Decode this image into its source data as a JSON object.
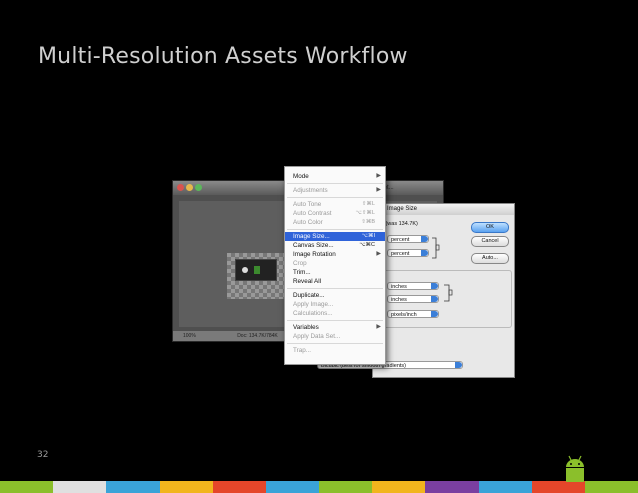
{
  "slide": {
    "title": "Multi-Resolution Assets Workflow",
    "page_number": "32"
  },
  "colors": {
    "background": "#000000",
    "title_text": "#cfcfcf",
    "menu_highlight": "#2f63d9",
    "bottom_stripes": [
      "#8bbf2b",
      "#e0e0e0",
      "#3aa3d8",
      "#f2b51d",
      "#e5462a",
      "#3aa3d8",
      "#8bbf2b",
      "#f2b51d",
      "#7a3fa0",
      "#3aa3d8",
      "#e5462a",
      "#8bbf2b"
    ]
  },
  "ps_window": {
    "title": "— Widget...",
    "zoom": "100%",
    "doc_info": "Doc: 134.7K/784K"
  },
  "menu": {
    "items": [
      {
        "label": "Mode",
        "submenu": true,
        "enabled": true
      },
      {
        "separator": true
      },
      {
        "label": "Adjustments",
        "submenu": true,
        "enabled": false
      },
      {
        "separator": true
      },
      {
        "label": "Auto Tone",
        "shortcut": "⇧⌘L",
        "enabled": false
      },
      {
        "label": "Auto Contrast",
        "shortcut": "⌥⇧⌘L",
        "enabled": false
      },
      {
        "label": "Auto Color",
        "shortcut": "⇧⌘B",
        "enabled": false
      },
      {
        "separator": true
      },
      {
        "label": "Image Size...",
        "shortcut": "⌥⌘I",
        "enabled": true,
        "selected": true
      },
      {
        "label": "Canvas Size...",
        "shortcut": "⌥⌘C",
        "enabled": true
      },
      {
        "label": "Image Rotation",
        "submenu": true,
        "enabled": true
      },
      {
        "label": "Crop",
        "enabled": false
      },
      {
        "label": "Trim...",
        "enabled": true
      },
      {
        "label": "Reveal All",
        "enabled": true
      },
      {
        "separator": true
      },
      {
        "label": "Duplicate...",
        "enabled": true
      },
      {
        "label": "Apply Image...",
        "enabled": false
      },
      {
        "label": "Calculations...",
        "enabled": false
      },
      {
        "separator": true
      },
      {
        "label": "Variables",
        "submenu": true,
        "enabled": true
      },
      {
        "label": "Apply Data Set...",
        "enabled": false
      },
      {
        "separator": true
      },
      {
        "label": "Trap...",
        "enabled": false
      }
    ]
  },
  "dialog": {
    "title": "Image Size",
    "pixel_dimensions_suffix": "OK (was 134.7K)",
    "ok_label": "OK",
    "cancel_label": "Cancel",
    "auto_label": "Auto...",
    "pixel_unit_1": "percent",
    "pixel_unit_2": "percent",
    "doc_unit_1": "inches",
    "doc_unit_2": "inches",
    "doc_unit_3": "pixels/inch",
    "resample_method": "Bicubic (best for smooth gradients)"
  }
}
